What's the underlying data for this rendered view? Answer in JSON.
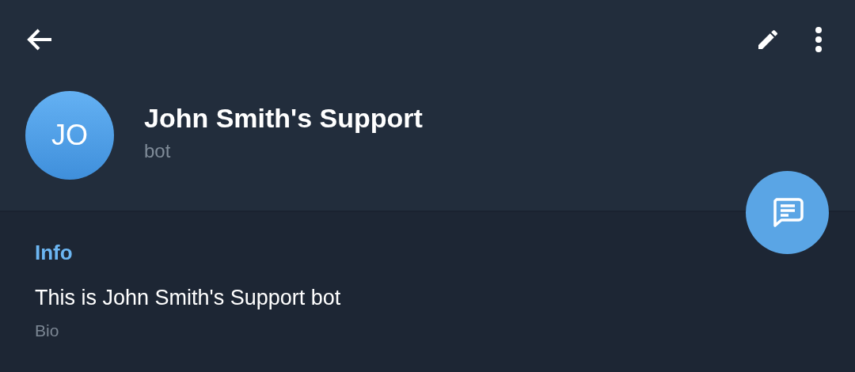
{
  "header": {
    "name": "John Smith's Support",
    "status": "bot",
    "avatar_initials": "JO"
  },
  "info": {
    "title": "Info",
    "fields": [
      {
        "value": "This is John Smith's Support bot",
        "label": "Bio"
      }
    ]
  }
}
